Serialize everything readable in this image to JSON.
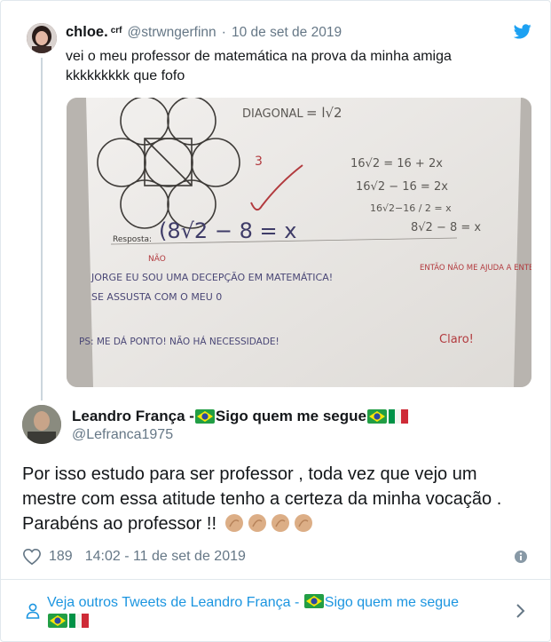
{
  "parent_tweet": {
    "name": "chloe.",
    "name_suffix": "crf",
    "handle": "@strwngerfinn",
    "separator": "·",
    "date": "10 de set de 2019",
    "text_line1": "vei o meu professor de matemática na prova da minha amiga",
    "text_line2": "kkkkkkkkk que fofo",
    "photo": {
      "diagonal_note": "DIAGONAL",
      "diagonal_eq": "= l√2",
      "calc_lines": [
        "16√2 = 16 + 2x",
        "16√2 − 16 = 2x",
        "16√2−16 / 2 = x",
        "8√2 − 8 = x"
      ],
      "answer_label": "Resposta:",
      "answer": "(8√2 − 8 = x",
      "score": "3",
      "student_line1": "JORGE EU SOU UMA DECEPÇÃO EM MATEMÁTICA!",
      "student_line2": "SE ASSUSTA COM O MEU 0",
      "student_ps": "PS: ME DÁ PONTO! NÃO HÁ NECESSIDADE!",
      "teacher_nao": "NÃO",
      "teacher_note": "ENTÃO NÃO ME AJUDA A ENTENDER MELHOR?",
      "teacher_claro": "Claro!"
    }
  },
  "reply_tweet": {
    "name": "Leandro França - ",
    "name_middle": "Sigo quem me segue",
    "handle": "@Lefranca1975",
    "text": "Por isso estudo para ser professor , toda vez que vejo um mestre com essa atitude tenho a certeza da minha vocação . Parabéns ao professor !!",
    "likes": "189",
    "time": "14:02",
    "date_sep": " - ",
    "date": "11 de set de 2019"
  },
  "footer": {
    "link_text": "Veja outros Tweets de Leandro França - ",
    "link_suffix": "Sigo quem me segue"
  },
  "icons": {
    "bird": "twitter-bird-icon",
    "heart": "heart-icon",
    "info": "info-icon",
    "user": "user-icon",
    "chevron": "chevron-right-icon",
    "clap": "clapping-hands-emoji",
    "flag_br": "brazil-flag-emoji",
    "flag_it": "italy-flag-emoji"
  },
  "colors": {
    "link": "#1b95e0",
    "muted": "#657786",
    "text": "#14171a",
    "border": "#e1e8ed",
    "bird": "#1da1f2"
  }
}
